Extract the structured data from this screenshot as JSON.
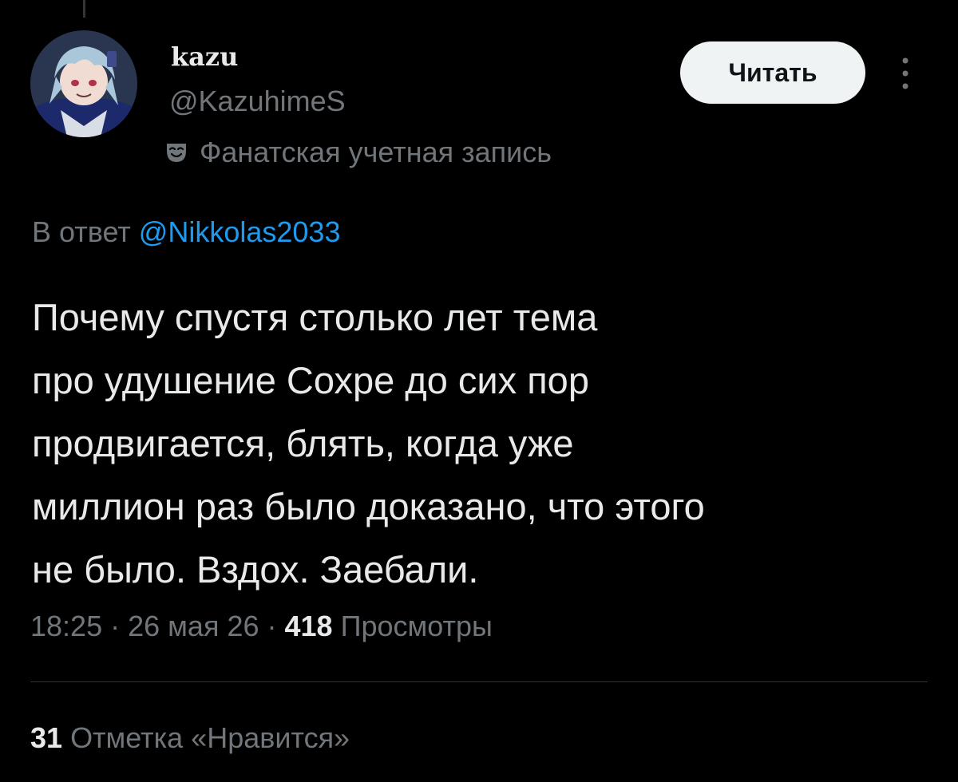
{
  "author": {
    "display_name": "kazu",
    "handle": "@KazuhimeS",
    "label": "Фанатская учетная запись",
    "label_icon": "theater-mask-icon"
  },
  "actions": {
    "follow_label": "Читать",
    "more_icon": "more-vertical-icon"
  },
  "reply": {
    "prefix": "В ответ",
    "mention": "@Nikkolas2033"
  },
  "tweet": {
    "text": "Почему спустя столько лет тема\nпро удушение Сохре до сих пор\nпродвигается, блять, когда уже\nмиллион раз было доказано, что этого\nне было. Вздох. Заебали."
  },
  "meta": {
    "time": "18:25",
    "separator": "·",
    "date": "26 мая 26",
    "views_count": "418",
    "views_label": "Просмотры"
  },
  "stats": {
    "likes_count": "31",
    "likes_label": "Отметка «Нравится»"
  },
  "colors": {
    "background": "#000000",
    "text_primary": "#e7e9ea",
    "text_secondary": "#71767b",
    "link": "#1d9bf0",
    "divider": "#2f3336",
    "button_bg": "#eff3f4"
  }
}
